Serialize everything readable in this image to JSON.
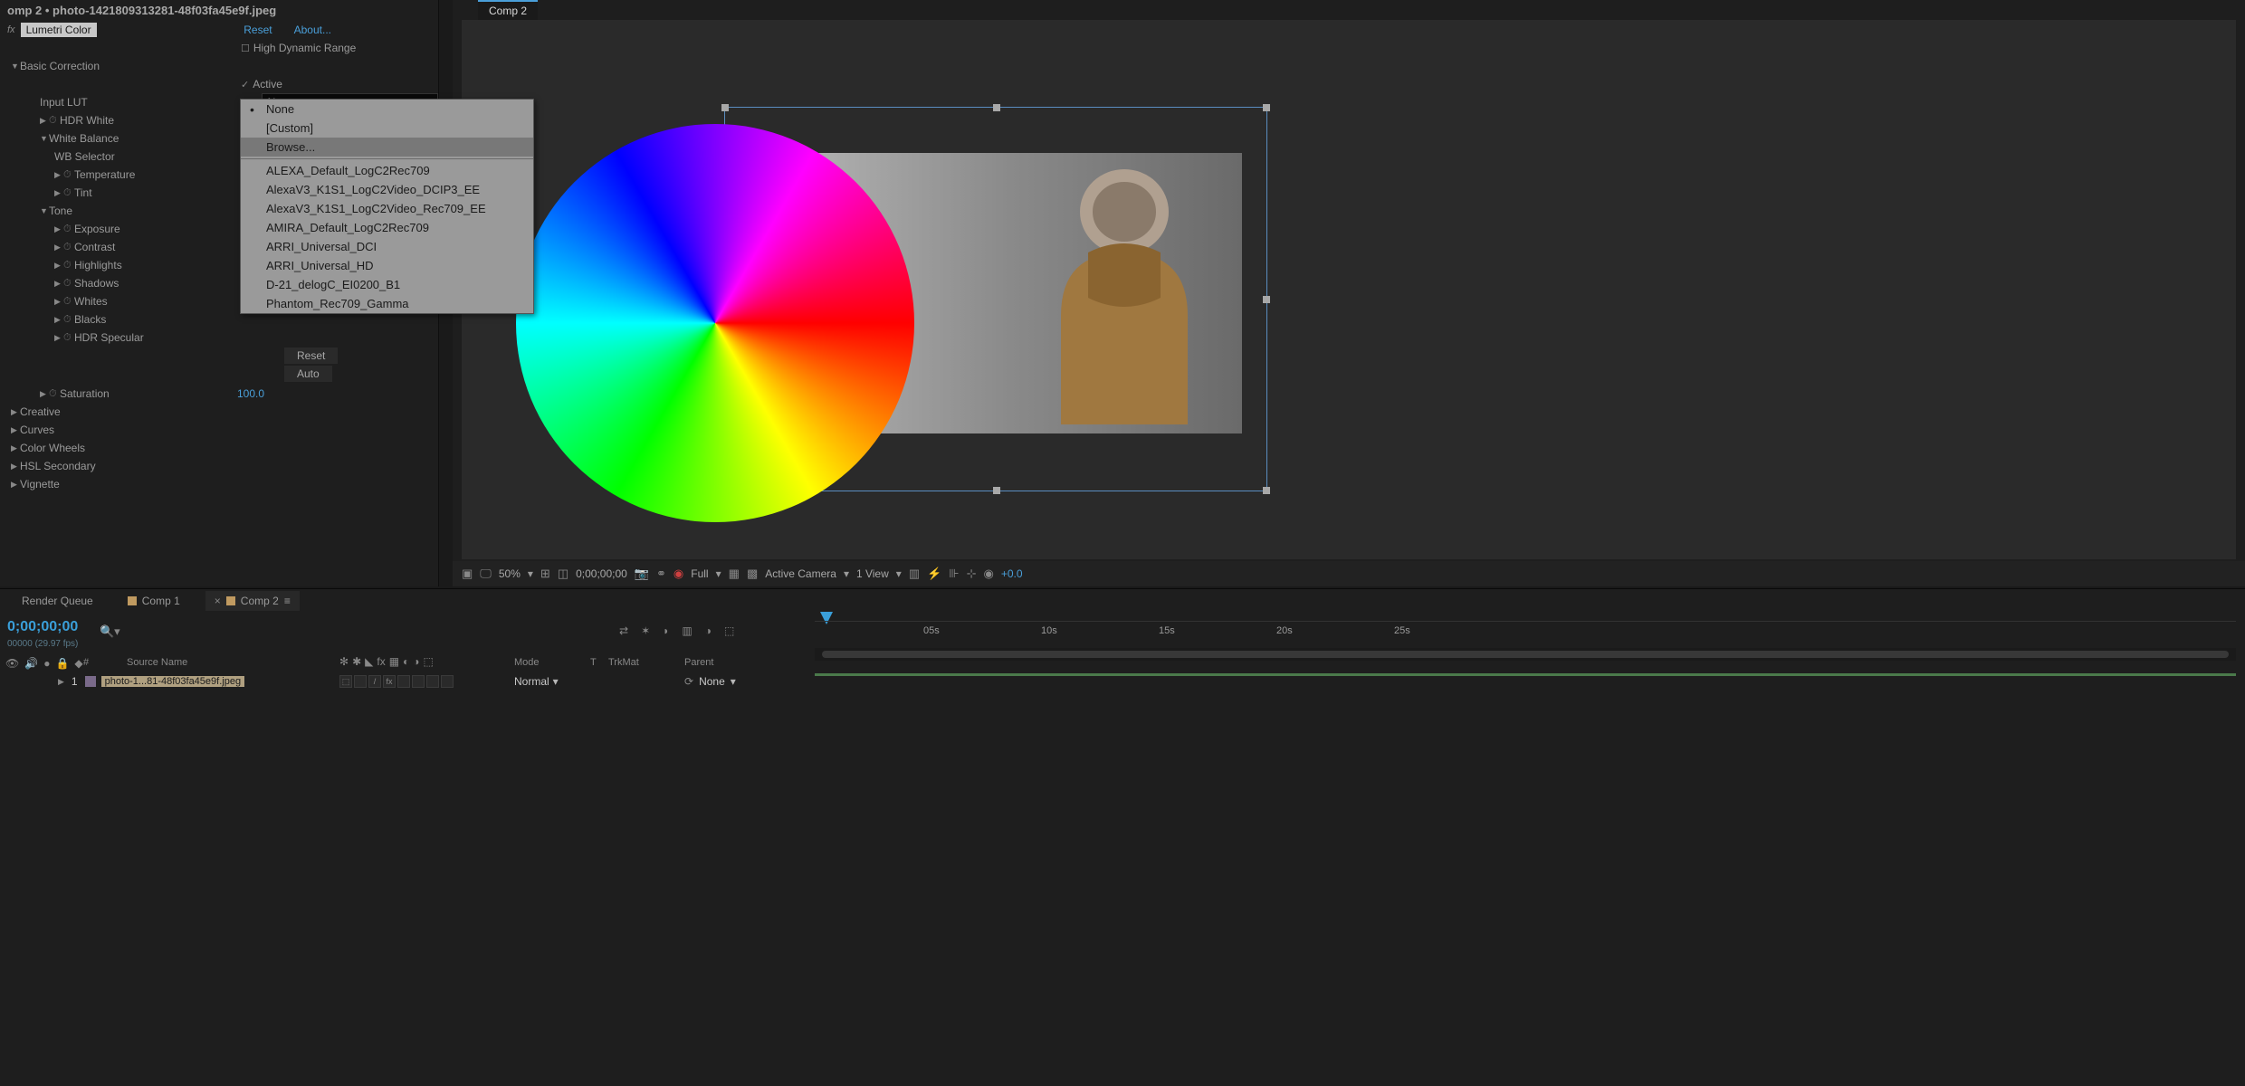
{
  "window_title": "omp 2 • photo-1421809313281-48f03fa45e9f.jpeg",
  "effect": {
    "name": "Lumetri Color",
    "reset": "Reset",
    "about": "About...",
    "hdr": "High Dynamic Range",
    "basic_correction": "Basic Correction",
    "active": "Active",
    "input_lut": "Input LUT",
    "input_lut_value": "None",
    "hdr_white": "HDR White",
    "white_balance": "White Balance",
    "wb_selector": "WB Selector",
    "temperature": "Temperature",
    "tint": "Tint",
    "tone": "Tone",
    "exposure": "Exposure",
    "contrast": "Contrast",
    "highlights": "Highlights",
    "shadows": "Shadows",
    "whites": "Whites",
    "blacks": "Blacks",
    "hdr_specular": "HDR Specular",
    "reset_btn": "Reset",
    "auto_btn": "Auto",
    "saturation": "Saturation",
    "saturation_value": "100.0",
    "creative": "Creative",
    "curves": "Curves",
    "color_wheels": "Color Wheels",
    "hsl_secondary": "HSL Secondary",
    "vignette": "Vignette"
  },
  "lut_dropdown": {
    "none": "None",
    "custom": "[Custom]",
    "browse": "Browse...",
    "items": [
      "ALEXA_Default_LogC2Rec709",
      "AlexaV3_K1S1_LogC2Video_DCIP3_EE",
      "AlexaV3_K1S1_LogC2Video_Rec709_EE",
      "AMIRA_Default_LogC2Rec709",
      "ARRI_Universal_DCI",
      "ARRI_Universal_HD",
      "D-21_delogC_EI0200_B1",
      "Phantom_Rec709_Gamma"
    ]
  },
  "viewer": {
    "tab": "Comp 2",
    "zoom": "50%",
    "timecode": "0;00;00;00",
    "resolution": "Full",
    "camera": "Active Camera",
    "view": "1 View",
    "exposure": "+0.0"
  },
  "tabs": {
    "render_queue": "Render Queue",
    "comp1": "Comp 1",
    "comp2": "Comp 2"
  },
  "timeline": {
    "time": "0;00;00;00",
    "fps": "00000 (29.97 fps)",
    "col_num": "#",
    "col_source": "Source Name",
    "col_mode": "Mode",
    "col_t": "T",
    "col_trkmat": "TrkMat",
    "col_parent": "Parent",
    "layer_num": "1",
    "layer_name": "photo-1...81-48f03fa45e9f.jpeg",
    "mode_value": "Normal",
    "parent_value": "None",
    "ticks": [
      "05s",
      "10s",
      "15s",
      "20s",
      "25s"
    ]
  }
}
